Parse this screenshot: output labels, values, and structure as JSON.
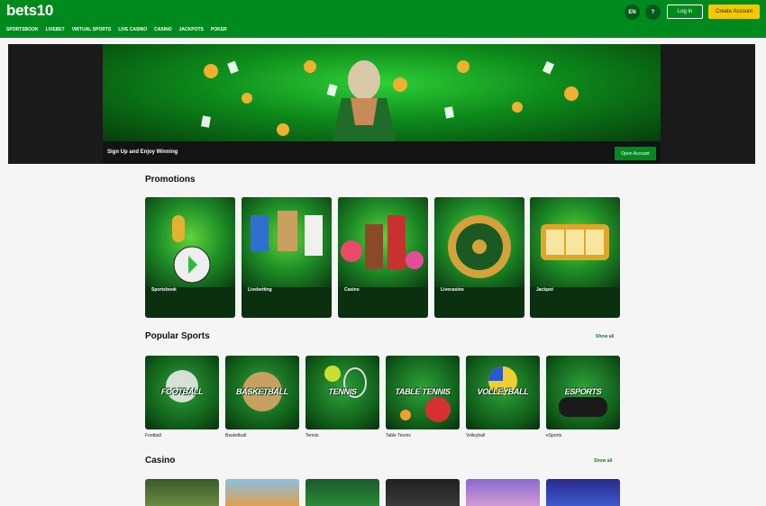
{
  "header": {
    "logo": "bets10",
    "lang": "EN",
    "help_label": "?",
    "login": "Log in",
    "create_account": "Create Account"
  },
  "nav": [
    "SPORTSBOOK",
    "LIVEBET",
    "VIRTUAL SPORTS",
    "LIVE CASINO",
    "CASINO",
    "JACKPOTS",
    "POKER"
  ],
  "banner": {
    "text": "Sign Up and Enjoy Winning",
    "button": "Open Account"
  },
  "promotions": {
    "title": "Promotions",
    "items": [
      "Sportsbook",
      "Livebetting",
      "Casino",
      "Livecasino",
      "Jackpot"
    ]
  },
  "popular_sports": {
    "title": "Popular Sports",
    "show_all": "Show all",
    "items": [
      {
        "title": "FOOTBALL",
        "label": "Football"
      },
      {
        "title": "BASKETBALL",
        "label": "Basketball"
      },
      {
        "title": "TENNIS",
        "label": "Tennis"
      },
      {
        "title": "TABLE TENNIS",
        "label": "Table Tennis"
      },
      {
        "title": "VOLLEYBALL",
        "label": "Volleyball"
      },
      {
        "title": "ESPORTS",
        "label": "eSports"
      }
    ]
  },
  "casino": {
    "title": "Casino",
    "show_all": "Show all"
  },
  "colors": {
    "brand_green": "#008a1e",
    "cta_yellow": "#f5c800"
  }
}
